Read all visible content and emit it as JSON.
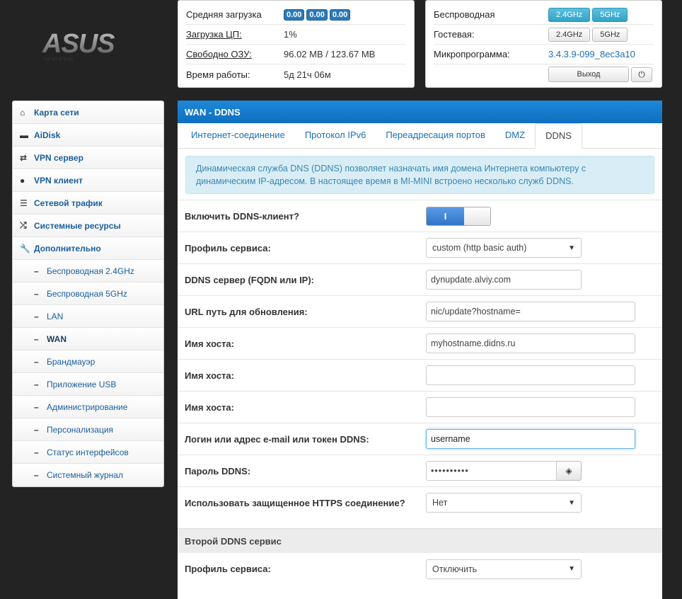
{
  "logo": {
    "text": "ASUS"
  },
  "status": {
    "load_label": "Средняя загрузка",
    "load_values": [
      "0.00",
      "0.00",
      "0.00"
    ],
    "cpu_label": "Загрузка ЦП:",
    "cpu_value": "1%",
    "ram_label": "Свободно ОЗУ:",
    "ram_value": "96.02 MB / 123.67 MB",
    "uptime_label": "Время работы:",
    "uptime_value": "5д 21ч 06м"
  },
  "wireless": {
    "wireless_label": "Беспроводная",
    "wireless_24": "2.4GHz",
    "wireless_5": "5GHz",
    "guest_label": "Гостевая:",
    "guest_24": "2.4GHz",
    "guest_5": "5GHz",
    "firmware_label": "Микропрограмма:",
    "firmware_value": "3.4.3.9-099_8ec3a10",
    "exit_label": "Выход",
    "power_icon": "power-icon"
  },
  "sidebar": {
    "items": [
      {
        "label": "Карта сети",
        "icon": "home-icon"
      },
      {
        "label": "AiDisk",
        "icon": "drive-icon"
      },
      {
        "label": "VPN сервер",
        "icon": "retweet-icon"
      },
      {
        "label": "VPN клиент",
        "icon": "globe-icon"
      },
      {
        "label": "Сетевой трафик",
        "icon": "list-icon"
      },
      {
        "label": "Системные ресурсы",
        "icon": "random-icon"
      },
      {
        "label": "Дополнительно",
        "icon": "wrench-icon"
      }
    ],
    "subitems": [
      {
        "label": "Беспроводная 2.4GHz"
      },
      {
        "label": "Беспроводная 5GHz"
      },
      {
        "label": "LAN"
      },
      {
        "label": "WAN"
      },
      {
        "label": "Брандмауэр"
      },
      {
        "label": "Приложение USB"
      },
      {
        "label": "Администрирование"
      },
      {
        "label": "Персонализация"
      },
      {
        "label": "Статус интерфейсов"
      },
      {
        "label": "Системный журнал"
      }
    ],
    "active_sub": "WAN"
  },
  "main": {
    "title": "WAN - DDNS",
    "tabs": [
      {
        "label": "Интернет-соединение"
      },
      {
        "label": "Протокол IPv6"
      },
      {
        "label": "Переадресация портов"
      },
      {
        "label": "DMZ"
      },
      {
        "label": "DDNS"
      }
    ],
    "active_tab": "DDNS",
    "info": "Динамическая служба DNS (DDNS) позволяет назначать имя домена Интернета компьютеру с динамическим IP-адресом. В настоящее время в MI-MINI встроено несколько служб DDNS.",
    "form": {
      "enable_label": "Включить DDNS-клиент?",
      "enable_state": "I",
      "profile_label": "Профиль сервиса:",
      "profile_value": "custom (http basic auth)",
      "server_label": "DDNS сервер (FQDN или IP):",
      "server_value": "dynupdate.alviy.com",
      "url_label": "URL путь для обновления:",
      "url_value": "nic/update?hostname=",
      "host1_label": "Имя хоста:",
      "host1_value": "myhostname.didns.ru",
      "host2_label": "Имя хоста:",
      "host2_value": "",
      "host3_label": "Имя хоста:",
      "host3_value": "",
      "login_label": "Логин или адрес e-mail или токен DDNS:",
      "login_value": "username",
      "password_label": "Пароль DDNS:",
      "password_value": "••••••••••",
      "https_label": "Использовать защищенное HTTPS соединение?",
      "https_value": "Нет"
    },
    "second": {
      "title": "Второй DDNS сервис",
      "profile_label": "Профиль сервиса:",
      "profile_value": "Отключить"
    }
  }
}
